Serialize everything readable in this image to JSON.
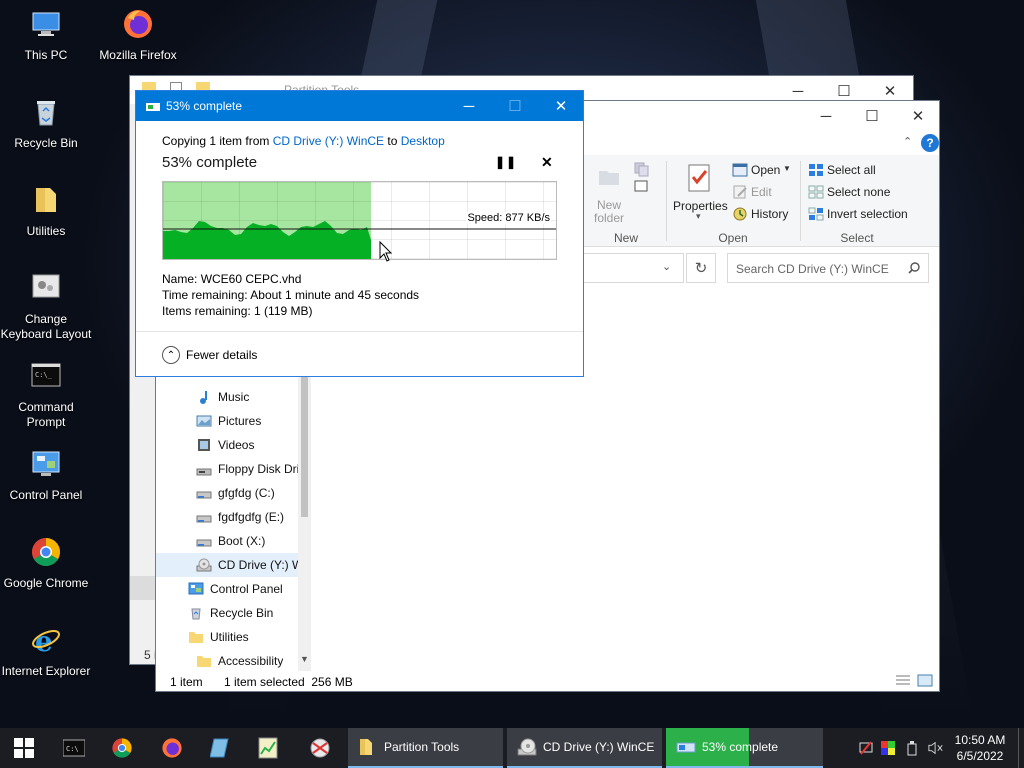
{
  "desktop": {
    "icons": [
      {
        "label": "This PC"
      },
      {
        "label": "Mozilla Firefox"
      },
      {
        "label": "Recycle Bin"
      },
      {
        "label": "Utilities"
      },
      {
        "label": "Change Keyboard Layout"
      },
      {
        "label": "Command Prompt"
      },
      {
        "label": "Control Panel"
      },
      {
        "label": "Google Chrome"
      },
      {
        "label": "Internet Explorer"
      }
    ]
  },
  "back_window": {
    "title": "Partition Tools",
    "status": "5 i"
  },
  "explorer": {
    "ribbon": {
      "new_folder": "New folder",
      "group_new": "New",
      "properties": "Properties",
      "open": "Open",
      "edit": "Edit",
      "history": "History",
      "group_open": "Open",
      "select_all": "Select all",
      "select_none": "Select none",
      "invert_selection": "Invert selection",
      "group_select": "Select"
    },
    "search_placeholder": "Search CD Drive (Y:) WinCE",
    "nav": [
      "Music",
      "Pictures",
      "Videos",
      "Floppy Disk Dri",
      "gfgfdg (C:)",
      "fgdfgdfg (E:)",
      "Boot (X:)",
      "CD Drive (Y:) W",
      "Control Panel",
      "Recycle Bin",
      "Utilities",
      "Accessibility"
    ],
    "status": {
      "count": "1 item",
      "selected": "1 item selected  256 MB"
    }
  },
  "copy_dialog": {
    "title": "53% complete",
    "copying_prefix": "Copying 1 item from ",
    "source": "CD Drive (Y:) WinCE",
    "to": " to ",
    "destination": "Desktop",
    "percent_text": "53% complete",
    "progress": 0.53,
    "speed": "Speed: 877 KB/s",
    "name_label": "Name:",
    "name_value": "WCE60 CEPC.vhd",
    "time_label": "Time remaining:",
    "time_value": "About 1 minute and 45 seconds",
    "items_label": "Items remaining:",
    "items_value": "1 (119 MB)",
    "fewer_details": "Fewer details"
  },
  "taskbar": {
    "tasks": [
      {
        "label": "Partition Tools"
      },
      {
        "label": "CD Drive (Y:) WinCE"
      },
      {
        "label": "53% complete"
      }
    ],
    "clock": {
      "time": "10:50 AM",
      "date": "6/5/2022"
    }
  },
  "colors": {
    "accent": "#0078d7",
    "progress_fill": "#06b025",
    "progress_light": "#a6e6a0",
    "link": "#0066cc",
    "taskbar": "#1b1d22"
  }
}
